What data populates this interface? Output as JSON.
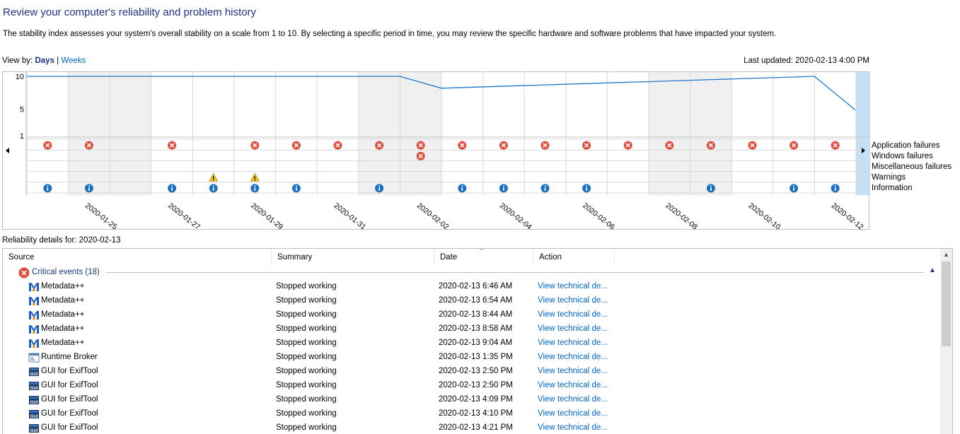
{
  "header": {
    "title": "Review your computer's reliability and problem history",
    "description": "The stability index assesses your system's overall stability on a scale from 1 to 10. By selecting a specific period in time, you may review the specific hardware and software problems that have impacted your system.",
    "view_by_label": "View by:",
    "view_days": "Days",
    "view_separator": "|",
    "view_weeks": "Weeks",
    "last_updated": "Last updated: 2020-02-13 4:00 PM"
  },
  "chart_data": {
    "type": "line",
    "y_ticks": [
      "10",
      "5",
      "1"
    ],
    "ylim": [
      1,
      10
    ],
    "days": [
      "2020-01-24",
      "2020-01-25",
      "2020-01-26",
      "2020-01-27",
      "2020-01-28",
      "2020-01-29",
      "2020-01-30",
      "2020-01-31",
      "2020-02-01",
      "2020-02-02",
      "2020-02-03",
      "2020-02-04",
      "2020-02-05",
      "2020-02-06",
      "2020-02-07",
      "2020-02-08",
      "2020-02-09",
      "2020-02-10",
      "2020-02-11",
      "2020-02-12"
    ],
    "x_labels": [
      "2020-01-25",
      "2020-01-27",
      "2020-01-29",
      "2020-01-31",
      "2020-02-02",
      "2020-02-04",
      "2020-02-06",
      "2020-02-08",
      "2020-02-10",
      "2020-02-12"
    ],
    "stability_index": [
      10,
      10,
      10,
      10,
      10,
      10,
      10,
      10,
      10,
      10,
      8.2,
      8.4,
      8.6,
      8.8,
      9.0,
      9.2,
      9.4,
      9.6,
      9.8,
      10,
      4.9
    ],
    "selected_day": "2020-02-13",
    "rows": [
      "Application failures",
      "Windows failures",
      "Miscellaneous failures",
      "Warnings",
      "Information"
    ],
    "application_failures": [
      1,
      1,
      0,
      1,
      0,
      1,
      1,
      1,
      1,
      1,
      1,
      1,
      1,
      1,
      1,
      1,
      1,
      1,
      1,
      1
    ],
    "windows_failures": [
      0,
      0,
      0,
      0,
      0,
      0,
      0,
      0,
      0,
      1,
      0,
      0,
      0,
      0,
      0,
      0,
      0,
      0,
      0,
      0
    ],
    "misc_failures": [
      0,
      0,
      0,
      0,
      0,
      0,
      0,
      0,
      0,
      0,
      0,
      0,
      0,
      0,
      0,
      0,
      0,
      0,
      0,
      0
    ],
    "warnings": [
      0,
      0,
      0,
      0,
      1,
      1,
      0,
      0,
      0,
      0,
      0,
      0,
      0,
      0,
      0,
      0,
      0,
      0,
      0,
      0
    ],
    "information": [
      1,
      1,
      0,
      1,
      1,
      1,
      1,
      0,
      1,
      0,
      1,
      1,
      1,
      1,
      0,
      0,
      1,
      0,
      1,
      1
    ],
    "colors": {
      "line": "#1e78c8",
      "selected": "#c5e0f5",
      "weekend": "#f0f0f0",
      "error": "#e04b3c",
      "warning": "#f5c518",
      "info": "#1e6fc0"
    }
  },
  "details": {
    "label": "Reliability details for: 2020-02-13",
    "columns": [
      "Source",
      "Summary",
      "Date",
      "Action"
    ],
    "group_label": "Critical events (18)",
    "rows": [
      {
        "source": "Metadata++",
        "icon": "metadata-app-icon",
        "summary": "Stopped working",
        "date": "2020-02-13 6:46 AM",
        "action": "View technical de..."
      },
      {
        "source": "Metadata++",
        "icon": "metadata-app-icon",
        "summary": "Stopped working",
        "date": "2020-02-13 6:54 AM",
        "action": "View technical de..."
      },
      {
        "source": "Metadata++",
        "icon": "metadata-app-icon",
        "summary": "Stopped working",
        "date": "2020-02-13 8:44 AM",
        "action": "View technical de..."
      },
      {
        "source": "Metadata++",
        "icon": "metadata-app-icon",
        "summary": "Stopped working",
        "date": "2020-02-13 8:58 AM",
        "action": "View technical de..."
      },
      {
        "source": "Metadata++",
        "icon": "metadata-app-icon",
        "summary": "Stopped working",
        "date": "2020-02-13 9:04 AM",
        "action": "View technical de..."
      },
      {
        "source": "Runtime Broker",
        "icon": "window-app-icon",
        "summary": "Stopped working",
        "date": "2020-02-13 1:35 PM",
        "action": "View technical de..."
      },
      {
        "source": "GUI for ExifTool",
        "icon": "gui-app-icon",
        "summary": "Stopped working",
        "date": "2020-02-13 2:50 PM",
        "action": "View technical de..."
      },
      {
        "source": "GUI for ExifTool",
        "icon": "gui-app-icon",
        "summary": "Stopped working",
        "date": "2020-02-13 2:50 PM",
        "action": "View technical de..."
      },
      {
        "source": "GUI for ExifTool",
        "icon": "gui-app-icon",
        "summary": "Stopped working",
        "date": "2020-02-13 4:09 PM",
        "action": "View technical de..."
      },
      {
        "source": "GUI for ExifTool",
        "icon": "gui-app-icon",
        "summary": "Stopped working",
        "date": "2020-02-13 4:10 PM",
        "action": "View technical de..."
      },
      {
        "source": "GUI for ExifTool",
        "icon": "gui-app-icon",
        "summary": "Stopped working",
        "date": "2020-02-13 4:21 PM",
        "action": "View technical de..."
      }
    ]
  }
}
